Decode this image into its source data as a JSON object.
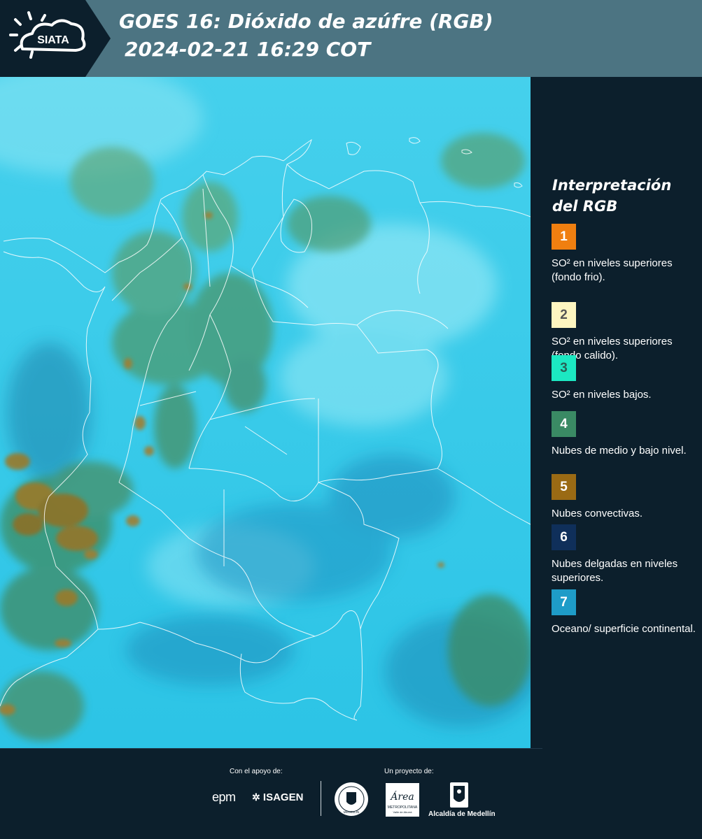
{
  "header": {
    "logo_text": "SIATA",
    "title_line1": "GOES 16: Dióxido de azúfre (RGB)",
    "title_line2": "2024-02-21 16:29 COT"
  },
  "legend": {
    "title_line1": "Interpretación",
    "title_line2": "del RGB",
    "items": [
      {
        "number": "1",
        "label": "SO² en niveles superiores (fondo frio).",
        "color": "#f07f10",
        "text_color": "#ffffff"
      },
      {
        "number": "2",
        "label": "SO² en niveles superiores (fondo calido).",
        "color": "#fdf5c0",
        "text_color": "#555555"
      },
      {
        "number": "3",
        "label": "SO² en niveles bajos.",
        "color": "#1ce8c2",
        "text_color": "#2a5f55"
      },
      {
        "number": "4",
        "label": "Nubes de medio y bajo nivel.",
        "color": "#3a8a64",
        "text_color": "#ffffff"
      },
      {
        "number": "5",
        "label": "Nubes convectivas.",
        "color": "#9a6a14",
        "text_color": "#ffffff"
      },
      {
        "number": "6",
        "label": "Nubes delgadas en niveles superiores.",
        "color": "#0f2f5a",
        "text_color": "#ffffff"
      },
      {
        "number": "7",
        "label": "Oceano/ superficie continental.",
        "color": "#1e9cc8",
        "text_color": "#ffffff"
      }
    ]
  },
  "footer": {
    "support_caption": "Con el apoyo de:",
    "project_caption": "Un proyecto de:",
    "sponsor1": "epm",
    "sponsor2": "ISAGEN",
    "partner_area": "Área",
    "partner_area_sub": "METROPOLITANA",
    "partner_area_sub2": "Valle de Aburrá",
    "partner_alcaldia": "Alcaldía de Medellín",
    "partner_seal": "MEDELLÍN"
  },
  "colors": {
    "background": "#0c1f2c",
    "header_band": "#4c7482",
    "ocean": "#2fc9e8",
    "cloud": "#3a8a64",
    "convective": "#9a6a14"
  }
}
